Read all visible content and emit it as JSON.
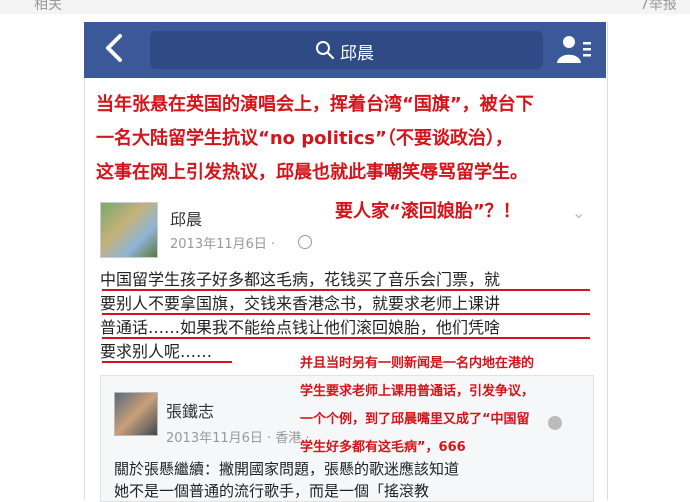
{
  "top": {
    "left_text": "相关",
    "right_text": "7举报"
  },
  "header": {
    "back_label": "<",
    "search_text": "邱晨"
  },
  "caption": {
    "line1": "当年张悬在英国的演唱会上，挥着台湾“国旗”，被台下",
    "line2": "一名大陆留学生抗议“no politics”（不要谈政治），",
    "line3": "这事在网上引发热议，邱晨也就此事嘲笑辱骂留学生。",
    "line4": "要人家“滚回娘胎”？！"
  },
  "post": {
    "author": "邱晨",
    "time": "2013年11月6日 · ",
    "lines": [
      "中国留学生孩子好多都这毛病，花钱买了音乐会门票，就",
      "要别人不要拿国旗，交钱来香港念书，就要求老师上课讲",
      "普通话……如果我不能给点钱让他们滚回娘胎，他们凭啥",
      "要求别人呢……"
    ],
    "chevron": "⌄"
  },
  "red_note": {
    "lines": [
      "并且当时另有一则新闻是一名内地在港的",
      "学生要求老师上课用普通话，引发争议，",
      "一个个例，到了邱晨嘴里又成了“中国留",
      "学生好多都有这毛病”，666"
    ]
  },
  "comment": {
    "author": "張鐵志",
    "time": "2013年11月6日 · 香港 · ",
    "lines": [
      "關於張懸繼續：撇開國家問題，張懸的歌迷應該知道",
      "她不是一個普通的流行歌手，而是一個「搖滾教"
    ]
  },
  "colors": {
    "nav": "#3b5998",
    "accent_red": "#d4141a"
  }
}
